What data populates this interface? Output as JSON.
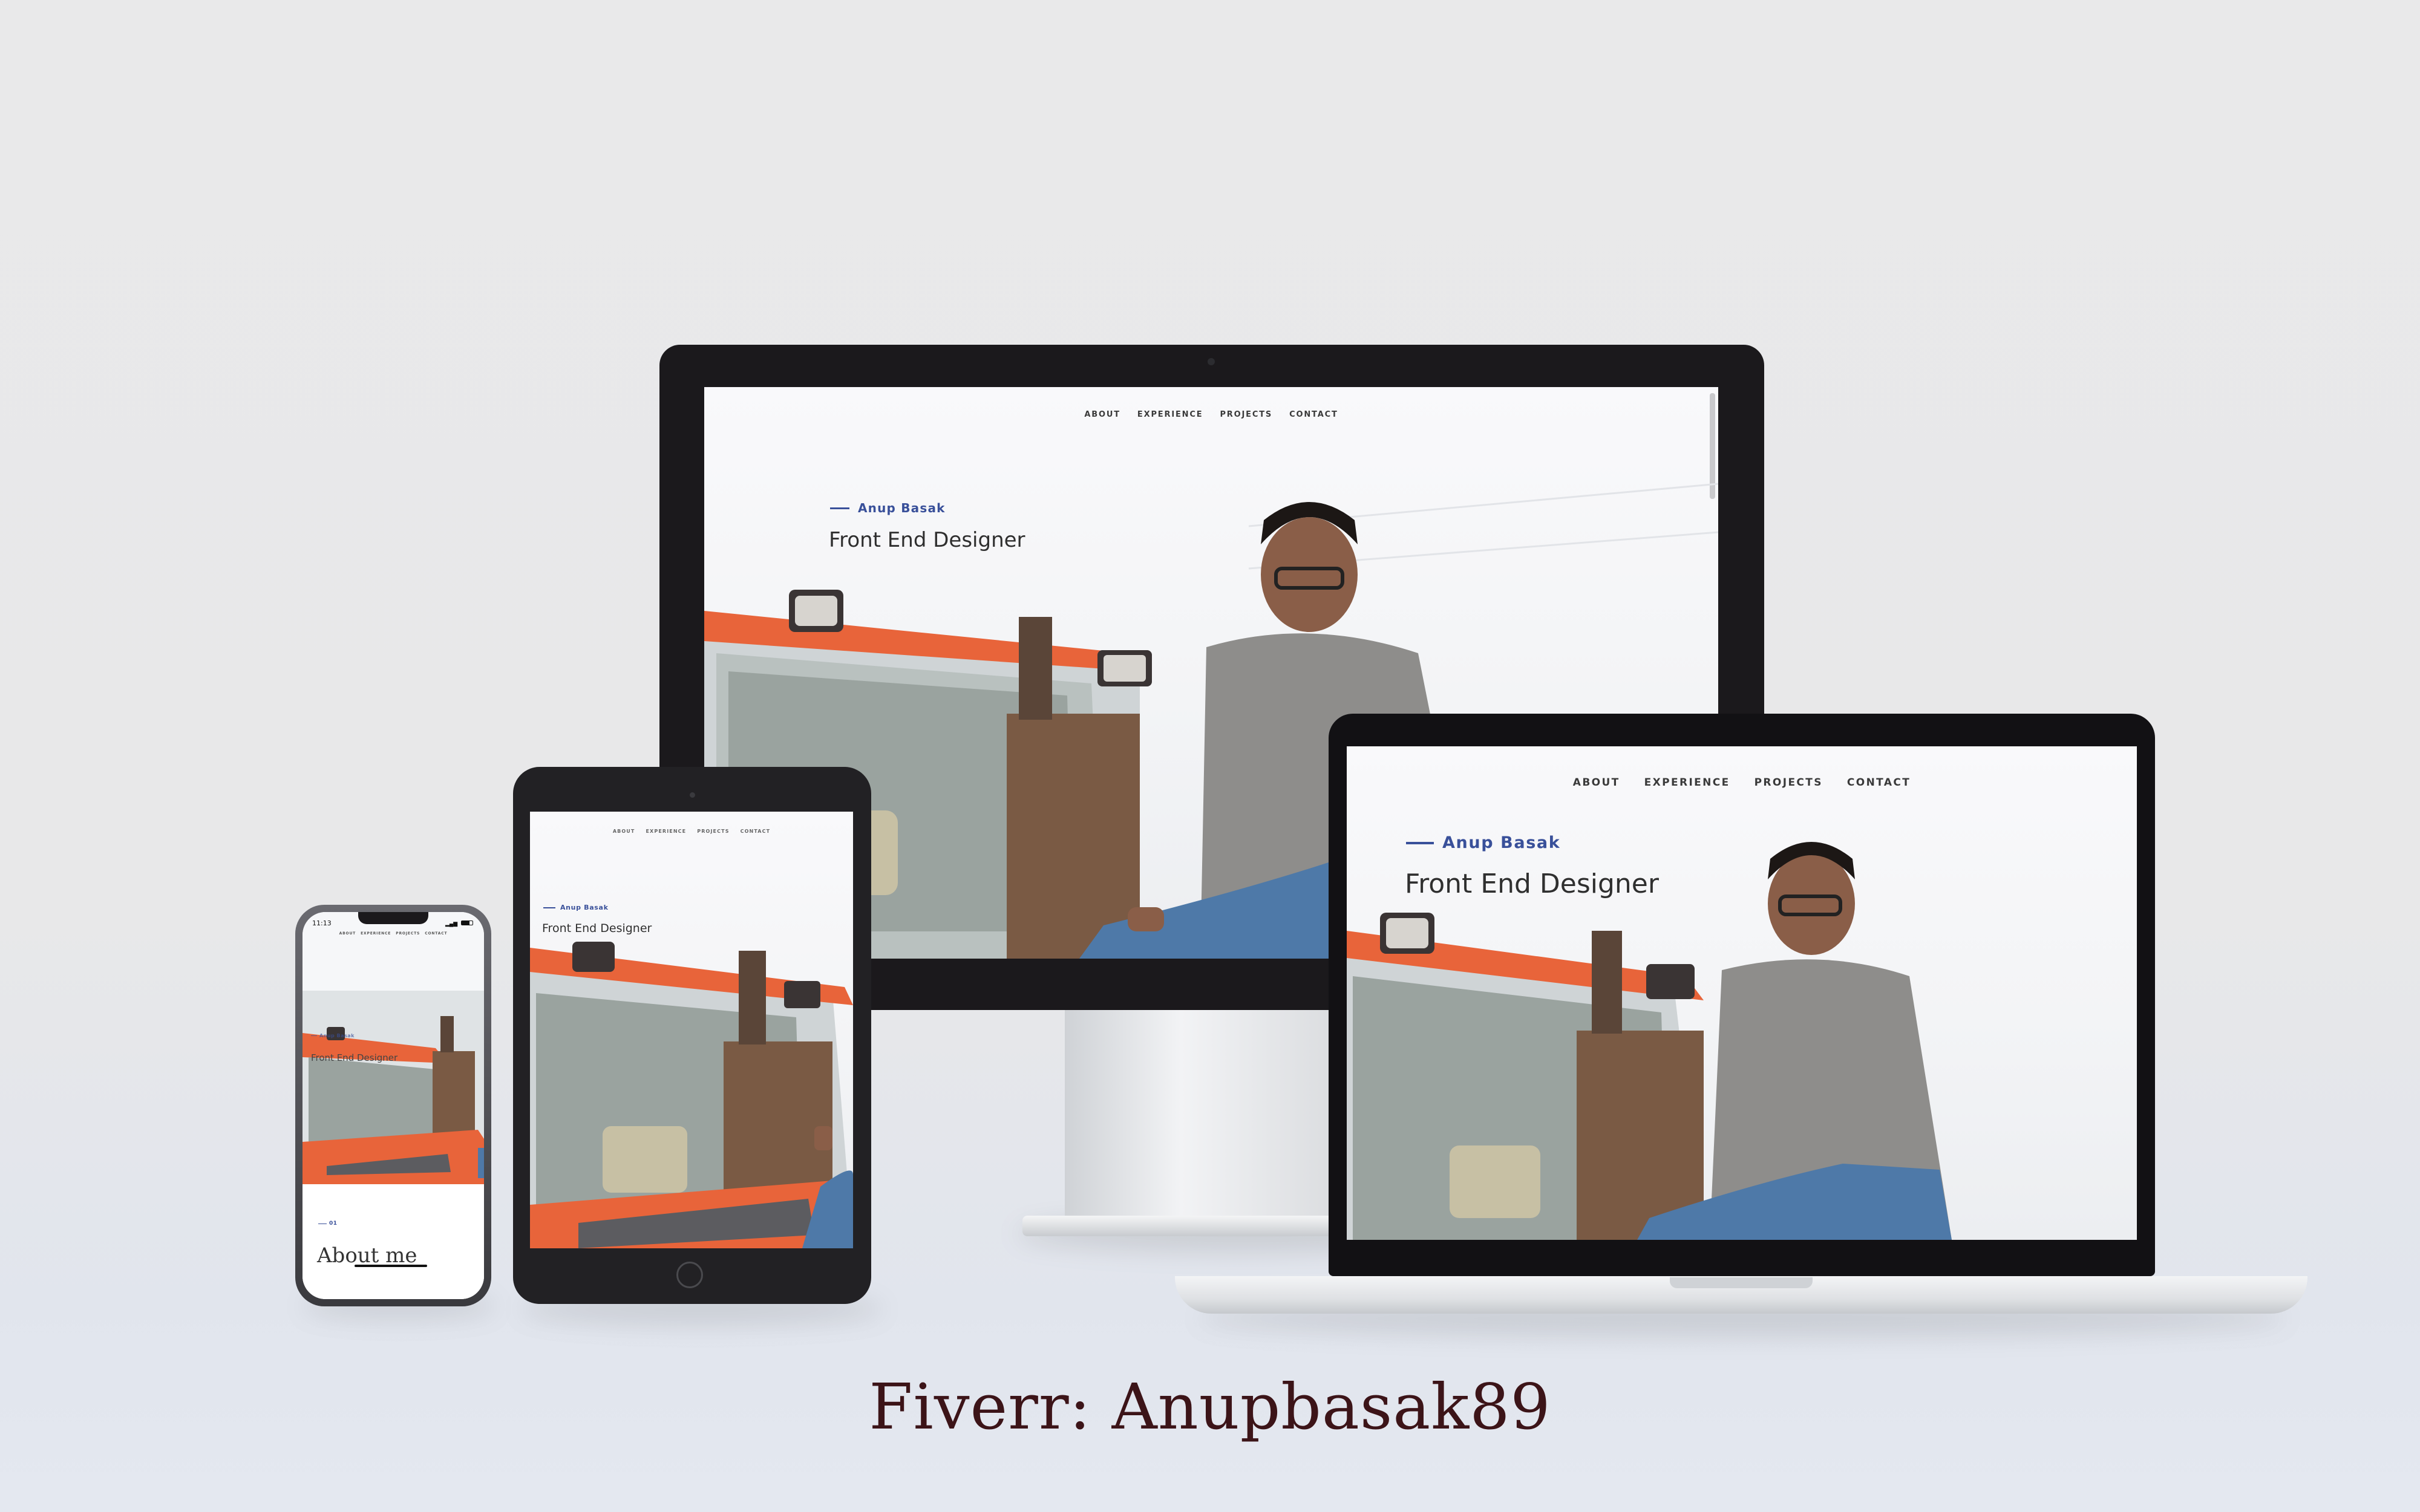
{
  "site": {
    "nav": [
      "ABOUT",
      "EXPERIENCE",
      "PROJECTS",
      "CONTACT"
    ],
    "name": "Anup Basak",
    "role": "Front End Designer"
  },
  "phone": {
    "status_time": "11:13",
    "section_number": "01",
    "section_title": "About me"
  },
  "watermark": "Fiverr: Anupbasak89",
  "colors": {
    "accent": "#39509a",
    "tractor": "#e8643a",
    "background": "#e9e9ea",
    "bezel": "#1b191c"
  }
}
